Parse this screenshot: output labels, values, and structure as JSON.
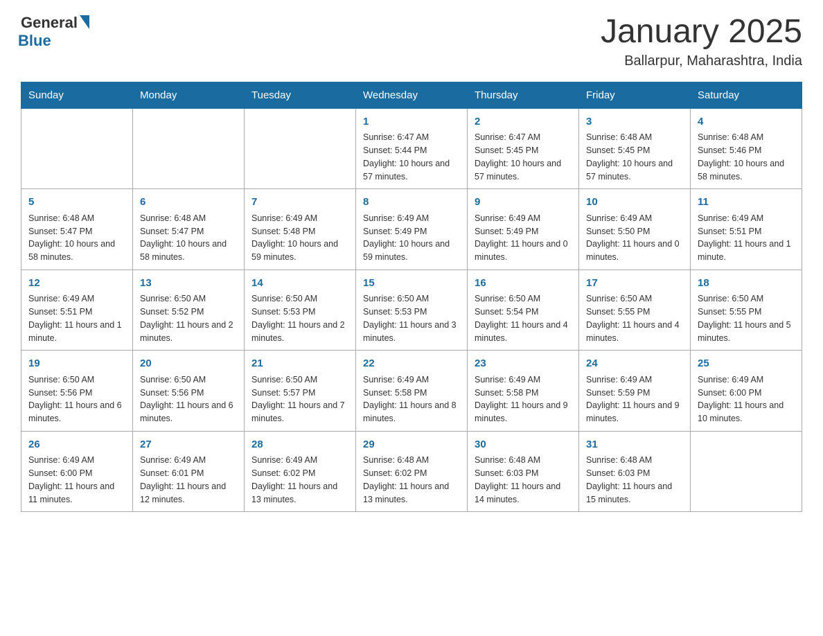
{
  "header": {
    "logo_general": "General",
    "logo_blue": "Blue",
    "month_title": "January 2025",
    "location": "Ballarpur, Maharashtra, India"
  },
  "days_of_week": [
    "Sunday",
    "Monday",
    "Tuesday",
    "Wednesday",
    "Thursday",
    "Friday",
    "Saturday"
  ],
  "weeks": [
    [
      {
        "day": "",
        "info": ""
      },
      {
        "day": "",
        "info": ""
      },
      {
        "day": "",
        "info": ""
      },
      {
        "day": "1",
        "info": "Sunrise: 6:47 AM\nSunset: 5:44 PM\nDaylight: 10 hours and 57 minutes."
      },
      {
        "day": "2",
        "info": "Sunrise: 6:47 AM\nSunset: 5:45 PM\nDaylight: 10 hours and 57 minutes."
      },
      {
        "day": "3",
        "info": "Sunrise: 6:48 AM\nSunset: 5:45 PM\nDaylight: 10 hours and 57 minutes."
      },
      {
        "day": "4",
        "info": "Sunrise: 6:48 AM\nSunset: 5:46 PM\nDaylight: 10 hours and 58 minutes."
      }
    ],
    [
      {
        "day": "5",
        "info": "Sunrise: 6:48 AM\nSunset: 5:47 PM\nDaylight: 10 hours and 58 minutes."
      },
      {
        "day": "6",
        "info": "Sunrise: 6:48 AM\nSunset: 5:47 PM\nDaylight: 10 hours and 58 minutes."
      },
      {
        "day": "7",
        "info": "Sunrise: 6:49 AM\nSunset: 5:48 PM\nDaylight: 10 hours and 59 minutes."
      },
      {
        "day": "8",
        "info": "Sunrise: 6:49 AM\nSunset: 5:49 PM\nDaylight: 10 hours and 59 minutes."
      },
      {
        "day": "9",
        "info": "Sunrise: 6:49 AM\nSunset: 5:49 PM\nDaylight: 11 hours and 0 minutes."
      },
      {
        "day": "10",
        "info": "Sunrise: 6:49 AM\nSunset: 5:50 PM\nDaylight: 11 hours and 0 minutes."
      },
      {
        "day": "11",
        "info": "Sunrise: 6:49 AM\nSunset: 5:51 PM\nDaylight: 11 hours and 1 minute."
      }
    ],
    [
      {
        "day": "12",
        "info": "Sunrise: 6:49 AM\nSunset: 5:51 PM\nDaylight: 11 hours and 1 minute."
      },
      {
        "day": "13",
        "info": "Sunrise: 6:50 AM\nSunset: 5:52 PM\nDaylight: 11 hours and 2 minutes."
      },
      {
        "day": "14",
        "info": "Sunrise: 6:50 AM\nSunset: 5:53 PM\nDaylight: 11 hours and 2 minutes."
      },
      {
        "day": "15",
        "info": "Sunrise: 6:50 AM\nSunset: 5:53 PM\nDaylight: 11 hours and 3 minutes."
      },
      {
        "day": "16",
        "info": "Sunrise: 6:50 AM\nSunset: 5:54 PM\nDaylight: 11 hours and 4 minutes."
      },
      {
        "day": "17",
        "info": "Sunrise: 6:50 AM\nSunset: 5:55 PM\nDaylight: 11 hours and 4 minutes."
      },
      {
        "day": "18",
        "info": "Sunrise: 6:50 AM\nSunset: 5:55 PM\nDaylight: 11 hours and 5 minutes."
      }
    ],
    [
      {
        "day": "19",
        "info": "Sunrise: 6:50 AM\nSunset: 5:56 PM\nDaylight: 11 hours and 6 minutes."
      },
      {
        "day": "20",
        "info": "Sunrise: 6:50 AM\nSunset: 5:56 PM\nDaylight: 11 hours and 6 minutes."
      },
      {
        "day": "21",
        "info": "Sunrise: 6:50 AM\nSunset: 5:57 PM\nDaylight: 11 hours and 7 minutes."
      },
      {
        "day": "22",
        "info": "Sunrise: 6:49 AM\nSunset: 5:58 PM\nDaylight: 11 hours and 8 minutes."
      },
      {
        "day": "23",
        "info": "Sunrise: 6:49 AM\nSunset: 5:58 PM\nDaylight: 11 hours and 9 minutes."
      },
      {
        "day": "24",
        "info": "Sunrise: 6:49 AM\nSunset: 5:59 PM\nDaylight: 11 hours and 9 minutes."
      },
      {
        "day": "25",
        "info": "Sunrise: 6:49 AM\nSunset: 6:00 PM\nDaylight: 11 hours and 10 minutes."
      }
    ],
    [
      {
        "day": "26",
        "info": "Sunrise: 6:49 AM\nSunset: 6:00 PM\nDaylight: 11 hours and 11 minutes."
      },
      {
        "day": "27",
        "info": "Sunrise: 6:49 AM\nSunset: 6:01 PM\nDaylight: 11 hours and 12 minutes."
      },
      {
        "day": "28",
        "info": "Sunrise: 6:49 AM\nSunset: 6:02 PM\nDaylight: 11 hours and 13 minutes."
      },
      {
        "day": "29",
        "info": "Sunrise: 6:48 AM\nSunset: 6:02 PM\nDaylight: 11 hours and 13 minutes."
      },
      {
        "day": "30",
        "info": "Sunrise: 6:48 AM\nSunset: 6:03 PM\nDaylight: 11 hours and 14 minutes."
      },
      {
        "day": "31",
        "info": "Sunrise: 6:48 AM\nSunset: 6:03 PM\nDaylight: 11 hours and 15 minutes."
      },
      {
        "day": "",
        "info": ""
      }
    ]
  ]
}
